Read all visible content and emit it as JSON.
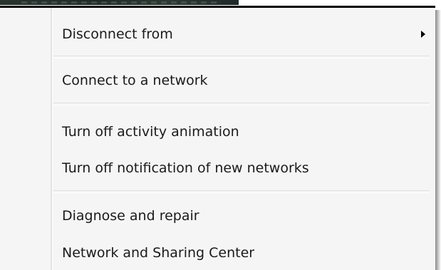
{
  "menu": {
    "items": [
      {
        "label": "Disconnect from",
        "has_submenu": true
      },
      {
        "label": "Connect to a network"
      },
      {
        "label": "Turn off activity animation"
      },
      {
        "label": "Turn off notification of new networks"
      },
      {
        "label": "Diagnose and repair"
      },
      {
        "label": "Network and Sharing Center"
      }
    ],
    "submenu_arrow_icon": "triangle-right-icon",
    "colors": {
      "background": "#f5f5f5",
      "text": "#1a1a1a",
      "separator": "#e0e0e0",
      "top_border": "#000000"
    }
  }
}
